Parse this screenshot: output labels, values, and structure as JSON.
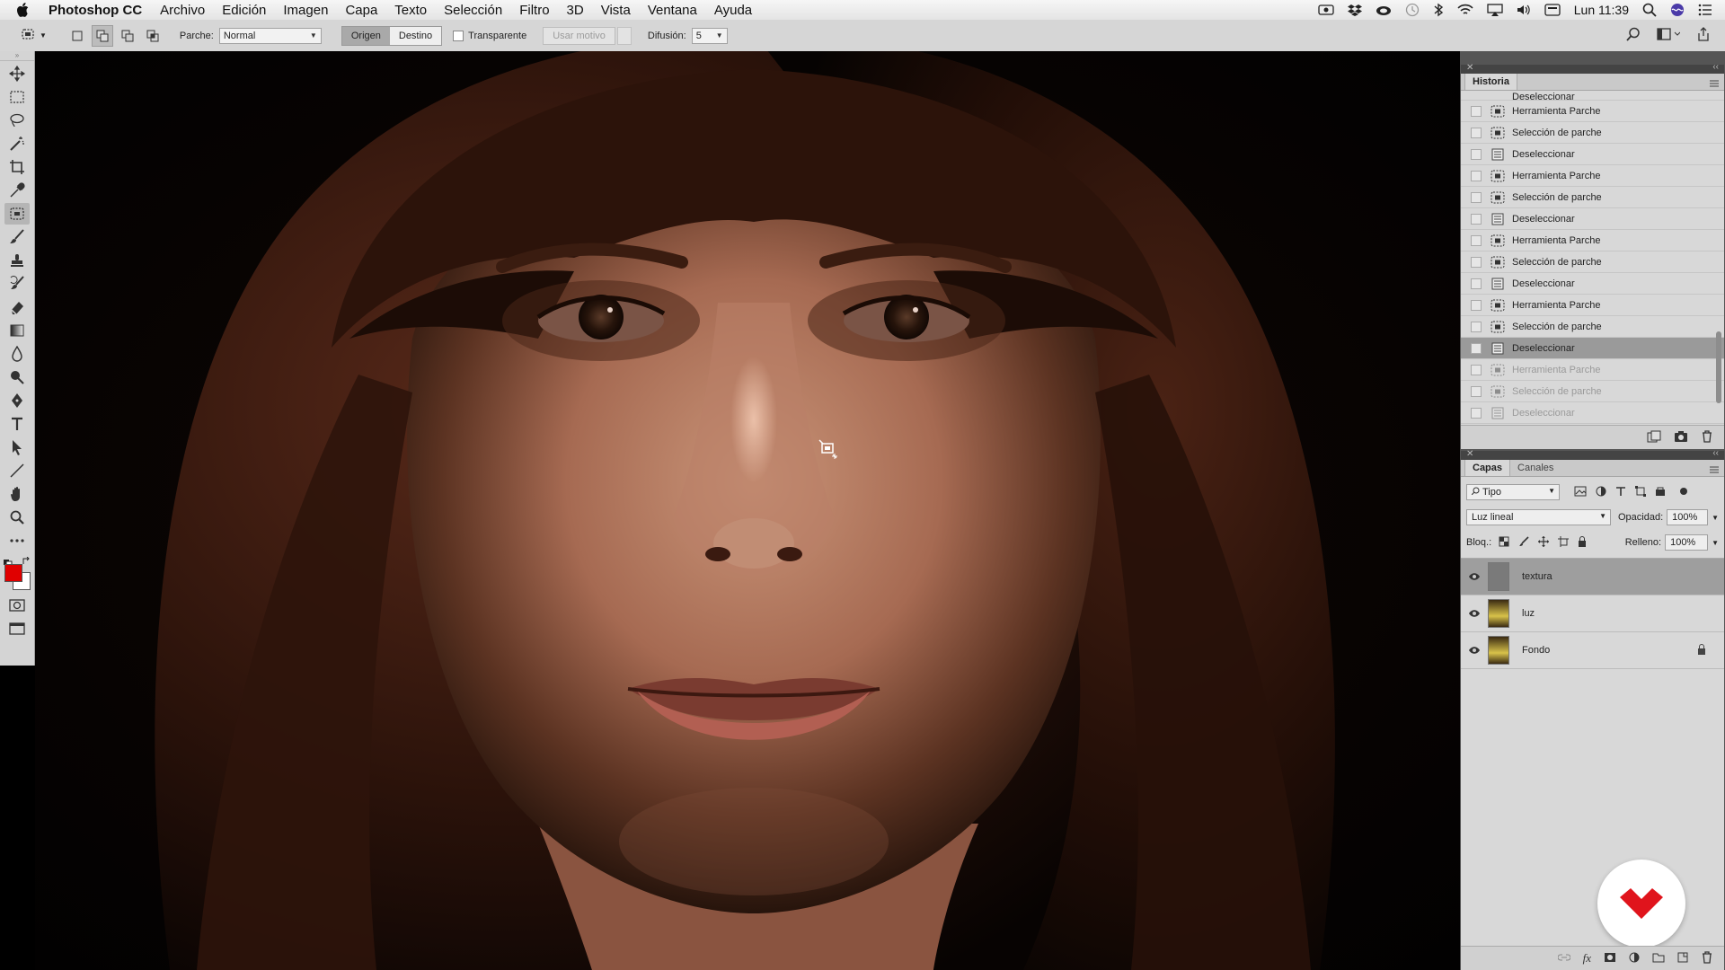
{
  "menubar": {
    "app_name": "Photoshop CC",
    "menus": [
      "Archivo",
      "Edición",
      "Imagen",
      "Capa",
      "Texto",
      "Selección",
      "Filtro",
      "3D",
      "Vista",
      "Ventana",
      "Ayuda"
    ],
    "clock": "Lun 11:39"
  },
  "options": {
    "patch_label": "Parche:",
    "patch_value": "Normal",
    "source_label": "Origen",
    "dest_label": "Destino",
    "transparent_label": "Transparente",
    "use_pattern_label": "Usar motivo",
    "diffusion_label": "Difusión:",
    "diffusion_value": "5"
  },
  "colors": {
    "foreground": "#e00000",
    "background": "#ffffff"
  },
  "history": {
    "tab": "Historia",
    "partial_top": "Deseleccionar",
    "items": [
      {
        "label": "Herramienta Parche",
        "icon": "patch-icon",
        "state": "normal"
      },
      {
        "label": "Selección de parche",
        "icon": "patch-selection-icon",
        "state": "normal"
      },
      {
        "label": "Deseleccionar",
        "icon": "document-icon",
        "state": "normal"
      },
      {
        "label": "Herramienta Parche",
        "icon": "patch-icon",
        "state": "normal"
      },
      {
        "label": "Selección de parche",
        "icon": "patch-selection-icon",
        "state": "normal"
      },
      {
        "label": "Deseleccionar",
        "icon": "document-icon",
        "state": "normal"
      },
      {
        "label": "Herramienta Parche",
        "icon": "patch-icon",
        "state": "normal"
      },
      {
        "label": "Selección de parche",
        "icon": "patch-selection-icon",
        "state": "normal"
      },
      {
        "label": "Deseleccionar",
        "icon": "document-icon",
        "state": "normal"
      },
      {
        "label": "Herramienta Parche",
        "icon": "patch-icon",
        "state": "normal"
      },
      {
        "label": "Selección de parche",
        "icon": "patch-selection-icon",
        "state": "normal"
      },
      {
        "label": "Deseleccionar",
        "icon": "document-icon",
        "state": "selected"
      },
      {
        "label": "Herramienta Parche",
        "icon": "patch-icon",
        "state": "dimmed"
      },
      {
        "label": "Selección de parche",
        "icon": "patch-selection-icon",
        "state": "dimmed"
      },
      {
        "label": "Deseleccionar",
        "icon": "document-icon",
        "state": "dimmed"
      }
    ]
  },
  "layers": {
    "tabs": [
      "Capas",
      "Canales"
    ],
    "filter_value": "Tipo",
    "blend_mode": "Luz lineal",
    "opacity_label": "Opacidad:",
    "opacity_value": "100%",
    "lock_label": "Bloq.:",
    "fill_label": "Relleno:",
    "fill_value": "100%",
    "items": [
      {
        "name": "textura",
        "selected": true,
        "visible": true,
        "locked": false
      },
      {
        "name": "luz",
        "selected": false,
        "visible": true,
        "locked": false
      },
      {
        "name": "Fondo",
        "selected": false,
        "visible": true,
        "locked": true
      }
    ]
  }
}
